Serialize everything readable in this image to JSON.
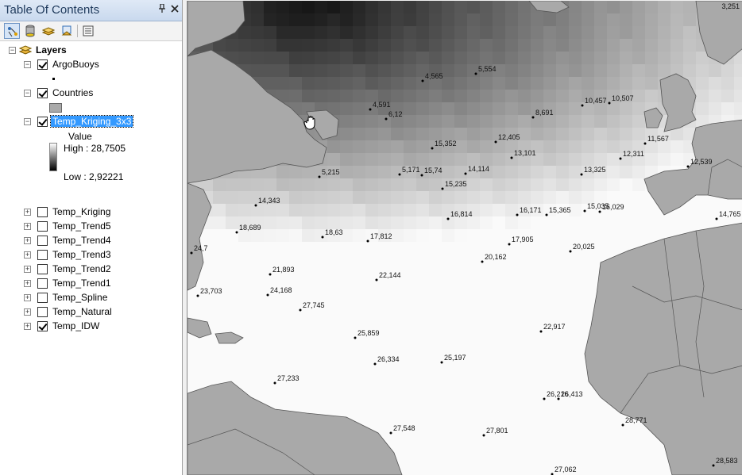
{
  "toc": {
    "title": "Table Of Contents",
    "pin_icon": "pin-icon",
    "close_icon": "close-icon",
    "toolbar": [
      {
        "name": "list-by-drawing-order",
        "active": true
      },
      {
        "name": "list-by-source"
      },
      {
        "name": "list-by-visibility"
      },
      {
        "name": "list-by-selection"
      },
      {
        "name": "options"
      }
    ],
    "root_label": "Layers",
    "layers": {
      "argo": {
        "label": "ArgoBuoys",
        "checked": true,
        "expanded": true
      },
      "countries": {
        "label": "Countries",
        "checked": true,
        "expanded": true
      },
      "kriging3x3": {
        "label": "Temp_Kriging_3x3",
        "checked": true,
        "expanded": true,
        "selected": true,
        "legend_title": "Value",
        "high": "High : 28,7505",
        "low": "Low : 2,92221"
      },
      "collapsed": [
        {
          "label": "Temp_Kriging",
          "checked": false
        },
        {
          "label": "Temp_Trend5",
          "checked": false
        },
        {
          "label": "Temp_Trend4",
          "checked": false
        },
        {
          "label": "Temp_Trend3",
          "checked": false
        },
        {
          "label": "Temp_Trend2",
          "checked": false
        },
        {
          "label": "Temp_Trend1",
          "checked": false
        },
        {
          "label": "Temp_Spline",
          "checked": false
        },
        {
          "label": "Temp_Natural",
          "checked": false
        },
        {
          "label": "Temp_IDW",
          "checked": true
        }
      ]
    }
  },
  "map": {
    "corner_label": "3,251",
    "colors": {
      "land": "#a9a9a9",
      "land_border": "#555555",
      "point": "#000000"
    },
    "points": [
      {
        "label": "5,554"
      },
      {
        "label": "4,565"
      },
      {
        "label": "4,591"
      },
      {
        "label": "6,12"
      },
      {
        "label": "8,691"
      },
      {
        "label": "10,457"
      },
      {
        "label": "10,507"
      },
      {
        "label": "15,352"
      },
      {
        "label": "12,405"
      },
      {
        "label": "11,567"
      },
      {
        "label": "13,101"
      },
      {
        "label": "12,311"
      },
      {
        "label": "12,539"
      },
      {
        "label": "5,215"
      },
      {
        "label": "5,171"
      },
      {
        "label": "15,74"
      },
      {
        "label": "14,114"
      },
      {
        "label": "13,325"
      },
      {
        "label": "15,235"
      },
      {
        "label": "14,343"
      },
      {
        "label": "16,814"
      },
      {
        "label": "16,171"
      },
      {
        "label": "15,365"
      },
      {
        "label": "15,035"
      },
      {
        "label": "16,029"
      },
      {
        "label": "14,765"
      },
      {
        "label": "18,689"
      },
      {
        "label": "18,63"
      },
      {
        "label": "17,812"
      },
      {
        "label": "17,905"
      },
      {
        "label": "24,7"
      },
      {
        "label": "20,162"
      },
      {
        "label": "20,025"
      },
      {
        "label": "21,893"
      },
      {
        "label": "22,144"
      },
      {
        "label": "23,703"
      },
      {
        "label": "24,168"
      },
      {
        "label": "27,745"
      },
      {
        "label": "25,859"
      },
      {
        "label": "22,917"
      },
      {
        "label": "26,334"
      },
      {
        "label": "25,197"
      },
      {
        "label": "27,233"
      },
      {
        "label": "26,216"
      },
      {
        "label": "26,413"
      },
      {
        "label": "28,771"
      },
      {
        "label": "27,548"
      },
      {
        "label": "27,801"
      },
      {
        "label": "27,062"
      },
      {
        "label": "28,583"
      }
    ]
  }
}
